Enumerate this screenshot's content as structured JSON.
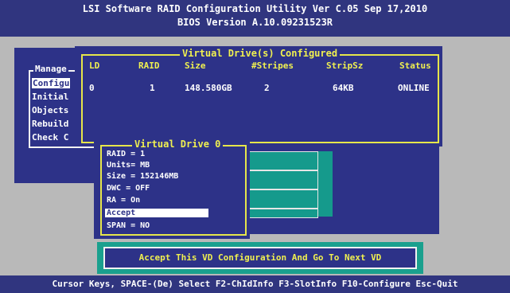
{
  "title": {
    "line1": "LSI Software RAID Configuration Utility Ver C.05 Sep 17,2010",
    "line2": "BIOS Version  A.10.09231523R"
  },
  "management_menu": {
    "title": "Manage",
    "items": [
      "Configu",
      "Initial",
      "Objects",
      "Rebuild",
      "Check C"
    ]
  },
  "vd_list": {
    "title": "Virtual Drive(s) Configured",
    "columns": [
      "LD",
      "RAID",
      "Size",
      "#Stripes",
      "StripSz",
      "Status"
    ],
    "rows": [
      {
        "ld": "0",
        "raid": "1",
        "size": "148.580GB",
        "stripes": "2",
        "stripsz": "64KB",
        "status": "ONLINE"
      }
    ]
  },
  "vd0": {
    "title": "Virtual Drive 0",
    "fields": [
      "RAID = 1",
      "Units= MB",
      "Size = 152146MB",
      "DWC  = OFF",
      "RA   = On",
      "Accept",
      "SPAN = NO"
    ],
    "selected_index": 5
  },
  "accept_button": "Accept This VD Configuration And Go To Next VD",
  "status_bar": "Cursor Keys, SPACE-(De) Select F2-ChIdInfo F3-SlotInfo F10-Configure Esc-Quit",
  "colors": {
    "panel": "#2d3288",
    "desktop": "#b9b9b9",
    "accent_yellow": "#f0f050",
    "teal": "#1aa08e"
  }
}
